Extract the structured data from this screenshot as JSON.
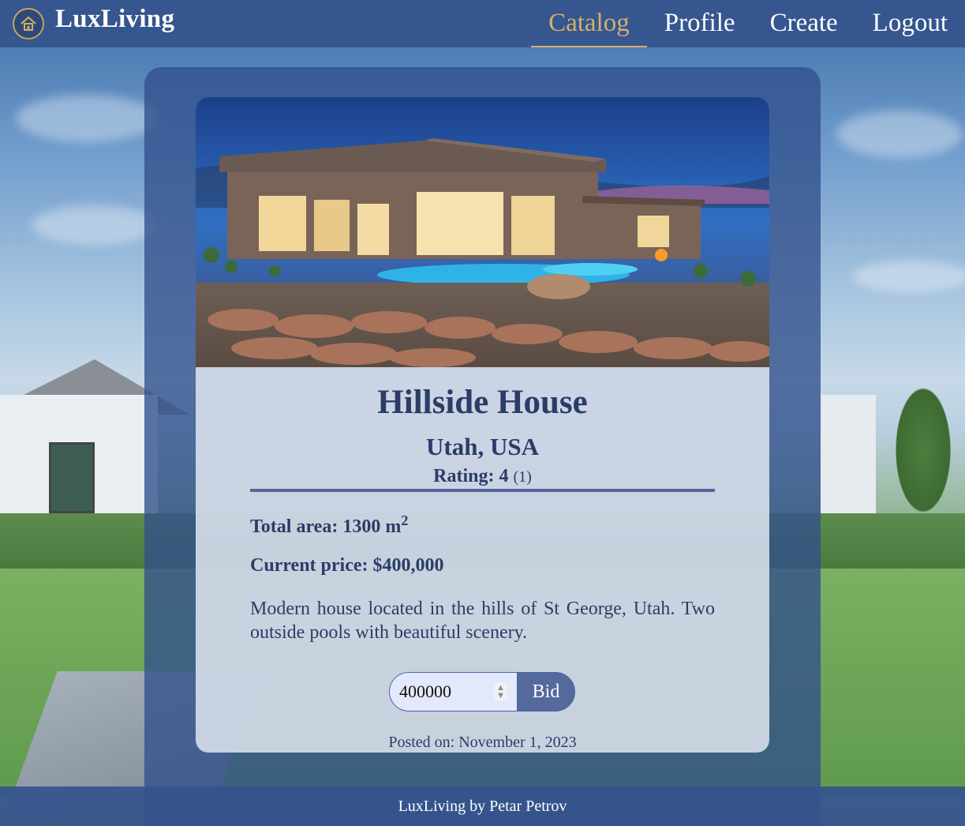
{
  "navbar": {
    "brand": "LuxLiving",
    "links": [
      {
        "label": "Catalog",
        "active": true
      },
      {
        "label": "Profile",
        "active": false
      },
      {
        "label": "Create",
        "active": false
      },
      {
        "label": "Logout",
        "active": false
      }
    ]
  },
  "listing": {
    "title": "Hillside House",
    "location": "Utah, USA",
    "rating_label": "Rating:",
    "rating_value": "4",
    "rating_count": "(1)",
    "area_label": "Total area:",
    "area_value": "1300 m",
    "area_unit_exponent": "2",
    "price_label": "Current price:",
    "price_value": "$400,000",
    "description": "Modern house located in the hills of St George, Utah. Two outside pools with beautiful scenery.",
    "bid_value": "400000",
    "bid_button": "Bid",
    "posted_label": "Posted on:",
    "posted_date": "November 1, 2023"
  },
  "footer": {
    "text": "LuxLiving by Petar Petrov"
  },
  "colors": {
    "nav_bg": "#34548c",
    "accent_gold": "#d4b06a",
    "text_navy": "#2b3d66",
    "button": "#56699d"
  },
  "icons": {
    "logo": "house-logo-icon",
    "spinner": "number-spinner-icon"
  }
}
